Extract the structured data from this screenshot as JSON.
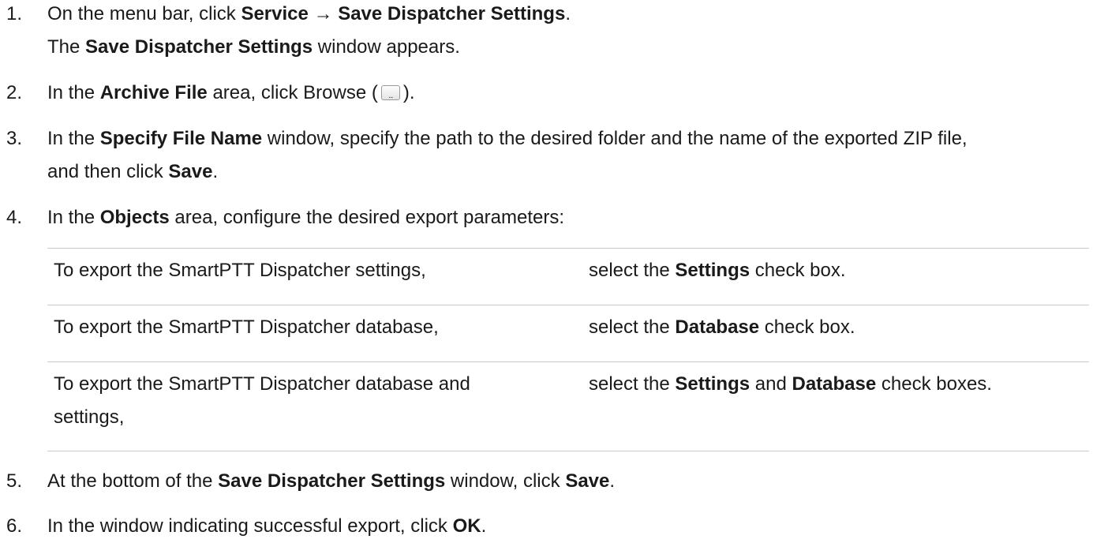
{
  "steps": [
    {
      "num": "1.",
      "a": "On the menu bar, click ",
      "b1": "Service",
      "c": " → ",
      "b2": "Save Dispatcher Settings",
      "d": ".",
      "l2a": "The ",
      "l2b": "Save Dispatcher Settings",
      "l2c": " window appears."
    },
    {
      "num": "2.",
      "a": "In the ",
      "b1": "Archive File",
      "c": " area, click Browse (",
      "icon": "browse-icon",
      "d": ")."
    },
    {
      "num": "3.",
      "a": "In the ",
      "b1": "Specify File Name",
      "c": " window, specify the path to the desired folder and the name of the exported ZIP file,",
      "l2a": "and then click ",
      "l2b": "Save",
      "l2c": "."
    },
    {
      "num": "4.",
      "a": "In the ",
      "b1": "Objects",
      "c": " area, configure the desired export parameters:"
    },
    {
      "num": "5.",
      "a": "At the bottom of the ",
      "b1": "Save Dispatcher Settings",
      "c": " window, click ",
      "b2": "Save",
      "d": "."
    },
    {
      "num": "6.",
      "a": "In the window indicating successful export, click ",
      "b1": "OK",
      "c": "."
    }
  ],
  "params": [
    {
      "left": "To export the SmartPTT Dispatcher settings,",
      "r_a": "select the ",
      "r_b1": "Settings",
      "r_c": " check box."
    },
    {
      "left": "To export the SmartPTT Dispatcher database,",
      "r_a": "select the ",
      "r_b1": "Database",
      "r_c": " check box."
    },
    {
      "left_l1": "To export the SmartPTT Dispatcher database and",
      "left_l2": "settings,",
      "r_a": "select the ",
      "r_b1": "Settings",
      "r_c": " and ",
      "r_b2": "Database",
      "r_d": " check boxes."
    }
  ]
}
